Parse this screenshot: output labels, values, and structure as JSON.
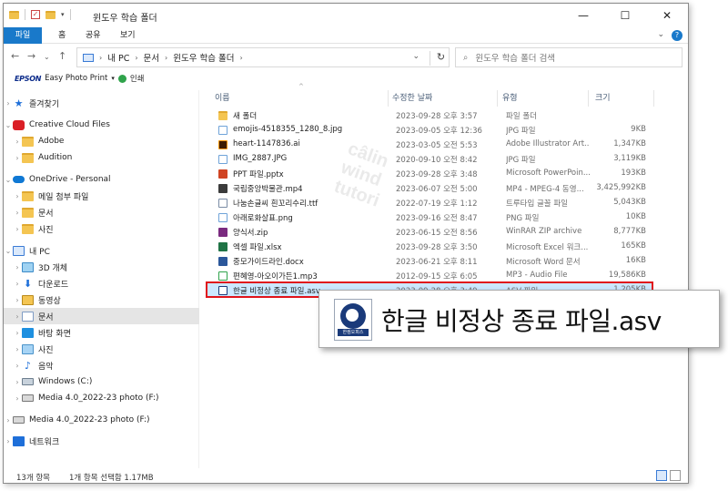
{
  "window": {
    "title": "윈도우 학습 폴더",
    "controls": [
      "—",
      "☐",
      "✕"
    ]
  },
  "ribbon": {
    "tabs": [
      "파일",
      "홈",
      "공유",
      "보기"
    ]
  },
  "address": {
    "path": [
      "내 PC",
      "문서",
      "윈도우 학습 폴더"
    ],
    "search_placeholder": "윈도우 학습 폴더 검색"
  },
  "epson_bar": {
    "brand": "EPSON",
    "app": "Easy Photo Print",
    "print": "인쇄"
  },
  "sidebar": {
    "items": [
      {
        "label": "즐겨찾기",
        "icon": "star-icon"
      },
      {
        "label": "Creative Cloud Files",
        "icon": "creative-cloud-icon"
      },
      {
        "label": "Adobe",
        "icon": "folder-icon"
      },
      {
        "label": "Audition",
        "icon": "folder-icon"
      },
      {
        "label": "OneDrive - Personal",
        "icon": "onedrive-icon"
      },
      {
        "label": "메일 첨부 파일",
        "icon": "folder-icon"
      },
      {
        "label": "문서",
        "icon": "folder-icon"
      },
      {
        "label": "사진",
        "icon": "folder-icon"
      },
      {
        "label": "내 PC",
        "icon": "pc-icon"
      },
      {
        "label": "3D 개체",
        "icon": "3d-objects-icon"
      },
      {
        "label": "다운로드",
        "icon": "download-icon"
      },
      {
        "label": "동영상",
        "icon": "video-icon"
      },
      {
        "label": "문서",
        "icon": "documents-icon"
      },
      {
        "label": "바탕 화면",
        "icon": "desktop-icon"
      },
      {
        "label": "사진",
        "icon": "pictures-icon"
      },
      {
        "label": "음악",
        "icon": "music-icon"
      },
      {
        "label": "Windows (C:)",
        "icon": "drive-icon"
      },
      {
        "label": "Media 4.0_2022-23 photo (F:)",
        "icon": "usb-drive-icon"
      },
      {
        "label": "Media 4.0_2022-23 photo (F:)",
        "icon": "usb-drive-icon"
      },
      {
        "label": "네트워크",
        "icon": "network-icon"
      }
    ]
  },
  "columns": {
    "name": "이름",
    "date": "수정한 날짜",
    "type": "유형",
    "size": "크기"
  },
  "files": [
    {
      "name": "새 폴더",
      "date": "2023-09-28 오후 3:57",
      "type": "파일 폴더",
      "size": ""
    },
    {
      "name": "emojis-4518355_1280_8.jpg",
      "date": "2023-09-05 오후 12:36",
      "type": "JPG 파일",
      "size": "9KB"
    },
    {
      "name": "heart-1147836.ai",
      "date": "2023-03-05 오전 5:53",
      "type": "Adobe Illustrator Art...",
      "size": "1,347KB"
    },
    {
      "name": "IMG_2887.JPG",
      "date": "2020-09-10 오전 8:42",
      "type": "JPG 파일",
      "size": "3,119KB"
    },
    {
      "name": "PPT 파일.pptx",
      "date": "2023-09-28 오후 3:48",
      "type": "Microsoft PowerPoin...",
      "size": "193KB"
    },
    {
      "name": "국립중앙박물관.mp4",
      "date": "2023-06-07 오전 5:00",
      "type": "MP4 - MPEG-4 동영...",
      "size": "3,425,992KB"
    },
    {
      "name": "나눔손글씨 흰꼬리수리.ttf",
      "date": "2022-07-19 오후 1:12",
      "type": "트루타입 글꼴 파일",
      "size": "5,043KB"
    },
    {
      "name": "아래로화살표.png",
      "date": "2023-09-16 오전 8:47",
      "type": "PNG 파일",
      "size": "10KB"
    },
    {
      "name": "양식서.zip",
      "date": "2023-06-15 오전 8:56",
      "type": "WinRAR ZIP archive",
      "size": "8,777KB"
    },
    {
      "name": "엑셀 파일.xlsx",
      "date": "2023-09-28 오후 3:50",
      "type": "Microsoft Excel 워크...",
      "size": "165KB"
    },
    {
      "name": "중모가이드라인.docx",
      "date": "2023-06-21 오후 8:11",
      "type": "Microsoft Word 문서",
      "size": "16KB"
    },
    {
      "name": "편혜영-아오이가든1.mp3",
      "date": "2012-09-15 오후 6:05",
      "type": "MP3 - Audio File",
      "size": "19,586KB"
    },
    {
      "name": "한글 비정상 종료 파일.asv",
      "date": "2023-09-28 오후 3:49",
      "type": "ASV 파일",
      "size": "1,205KB"
    }
  ],
  "callout": {
    "text": "한글 비정상 종료 파일.asv",
    "badge": "한컴오피스"
  },
  "watermark": [
    "câlin",
    "wind",
    "tutori"
  ],
  "status": {
    "count": "13개 항목",
    "selected": "1개 항목 선택함 1.17MB"
  }
}
